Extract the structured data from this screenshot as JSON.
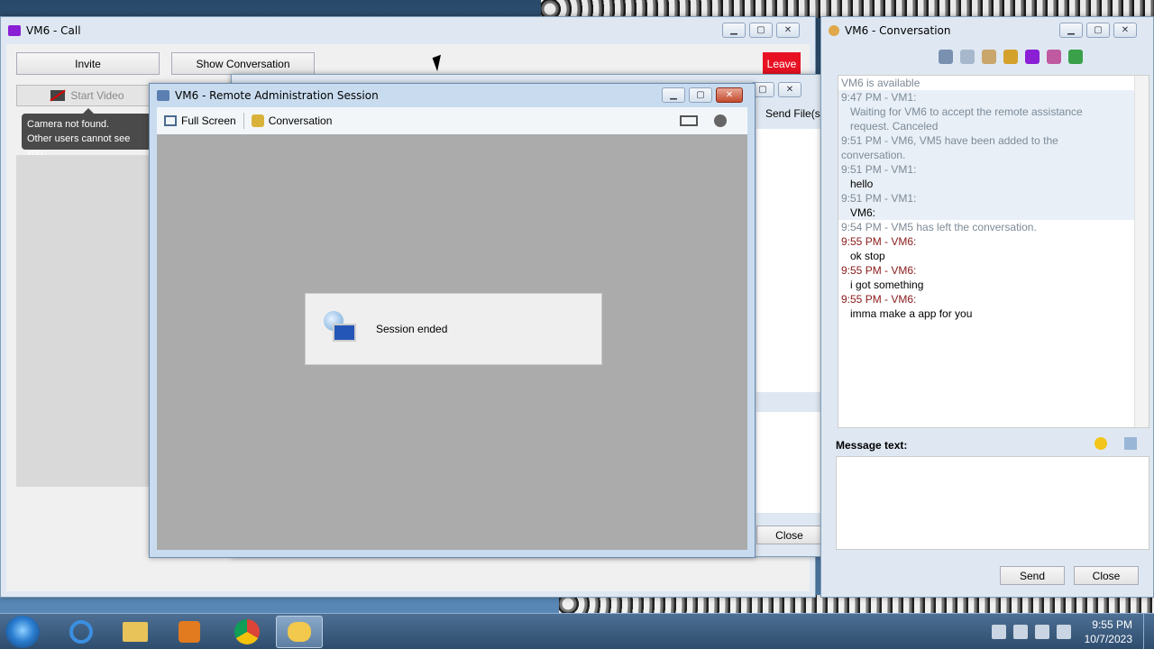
{
  "call_window": {
    "title": "VM6 - Call",
    "invite_label": "Invite",
    "show_conversation_label": "Show Conversation",
    "leave_label": "Leave",
    "start_video_label": "Start Video",
    "tooltip_line1": "Camera not found.",
    "tooltip_line2": "Other users cannot see you."
  },
  "hidden_conversation": {
    "send_files_label": "Send File(s)",
    "close_label": "Close"
  },
  "remote_window": {
    "title": "VM6 - Remote Administration Session",
    "fullscreen_label": "Full Screen",
    "conversation_label": "Conversation",
    "session_message": "Session ended"
  },
  "chat_window": {
    "title": "VM6 - Conversation",
    "messages": [
      {
        "text": "VM6 is available",
        "kind": "sys"
      },
      {
        "text": "9:47 PM - VM1:",
        "kind": "ts"
      },
      {
        "text": "Waiting for VM6 to accept the remote assistance",
        "kind": "sys-indent"
      },
      {
        "text": "request. Canceled",
        "kind": "sys-indent"
      },
      {
        "text": "9:51 PM - VM6, VM5 have been added to the",
        "kind": "sys"
      },
      {
        "text": "conversation.",
        "kind": "sys"
      },
      {
        "text": "9:51 PM - VM1:",
        "kind": "ts"
      },
      {
        "text": "hello",
        "kind": "body"
      },
      {
        "text": "9:51 PM - VM1:",
        "kind": "ts"
      },
      {
        "text": "VM6:",
        "kind": "body"
      },
      {
        "text": "9:54 PM - VM5 has left the conversation.",
        "kind": "sys"
      },
      {
        "text": "9:55 PM - VM6:",
        "kind": "ts-red"
      },
      {
        "text": "ok stop",
        "kind": "body"
      },
      {
        "text": "9:55 PM - VM6:",
        "kind": "ts-red"
      },
      {
        "text": "i got something",
        "kind": "body"
      },
      {
        "text": "9:55 PM - VM6:",
        "kind": "ts-red"
      },
      {
        "text": "imma make a app for you",
        "kind": "body"
      }
    ],
    "message_label": "Message text:",
    "send_label": "Send",
    "close_label": "Close"
  },
  "taskbar": {
    "time": "9:55 PM",
    "date": "10/7/2023"
  },
  "colors": {
    "leave": "#e81123",
    "timestamp_red": "#8a1a1a",
    "system_text": "#7d8a96"
  }
}
